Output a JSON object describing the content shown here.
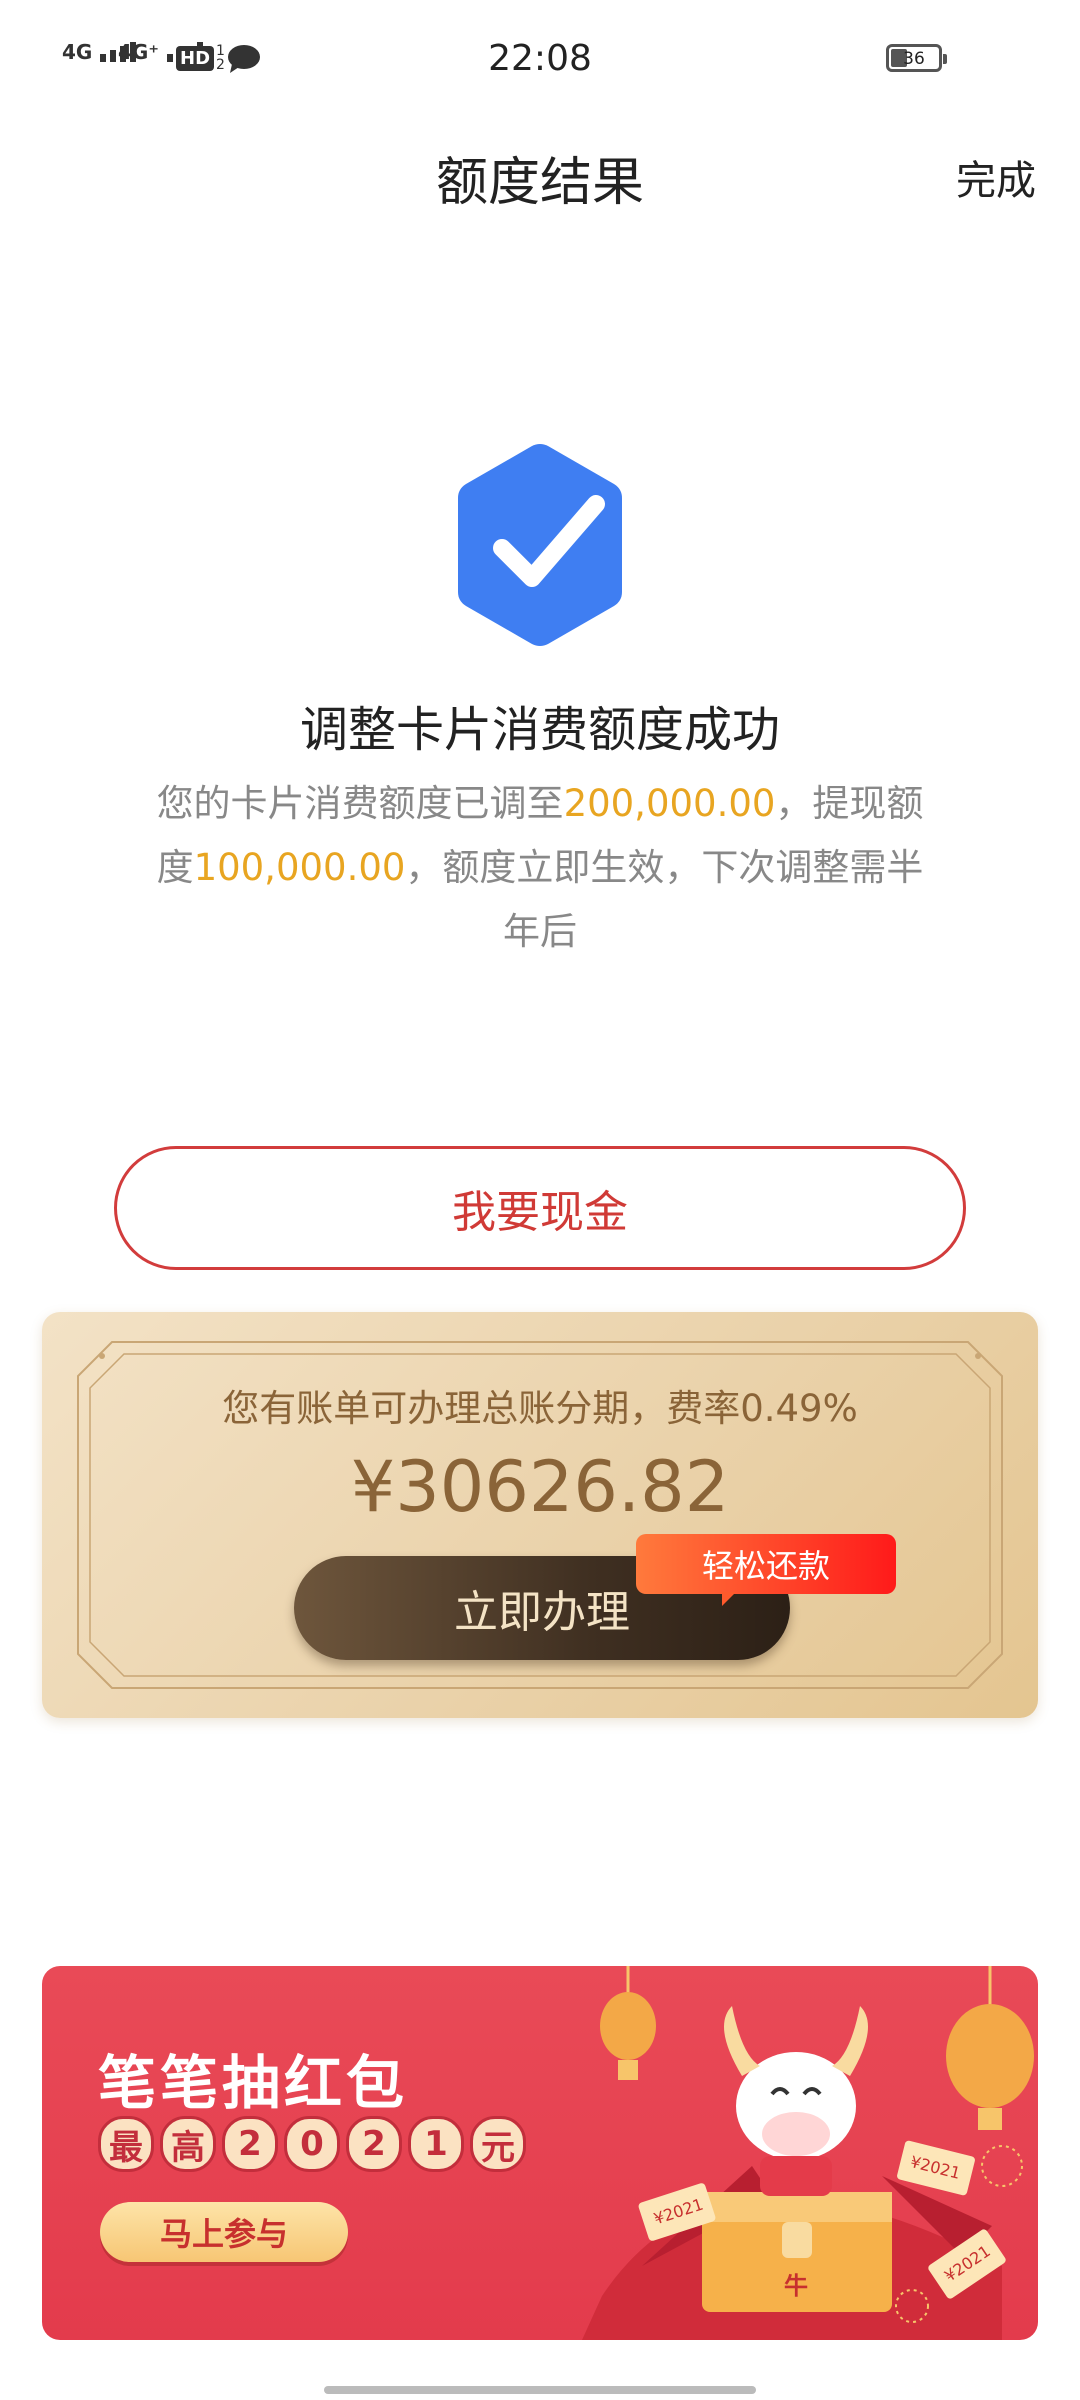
{
  "status_bar": {
    "signal1_label": "4G",
    "signal2_label": "4G⁺",
    "hd_label": "HD",
    "hd_sub_top": "1",
    "hd_sub_bottom": "2",
    "time": "22:08",
    "battery_level": "36"
  },
  "header": {
    "title": "额度结果",
    "done_label": "完成"
  },
  "result": {
    "icon": "check-hexagon-icon",
    "title": "调整卡片消费额度成功",
    "desc_part1": "您的卡片消费额度已调至",
    "consume_limit": "200,000.00",
    "desc_part2": "，提现额度",
    "cash_limit": "100,000.00",
    "desc_part3": "，额度立即生效，下次调整需半年后"
  },
  "cash_button": {
    "label": "我要现金"
  },
  "bill_card": {
    "text": "您有账单可办理总账分期，费率0.49%",
    "amount": "¥30626.82",
    "button_label": "立即办理",
    "tag_label": "轻松还款"
  },
  "banner": {
    "title": "笔笔抽红包",
    "sub_chars": [
      "最",
      "高",
      "2",
      "0",
      "2",
      "1",
      "元"
    ],
    "button_label": "马上参与",
    "art_labels": [
      "¥2021",
      "¥2021",
      "¥2021",
      "牛"
    ]
  },
  "colors": {
    "accent_blue": "#3f7ef2",
    "highlight_gold": "#e8a521",
    "cash_red": "#d03a36",
    "banner_red": "#e33b4c"
  }
}
